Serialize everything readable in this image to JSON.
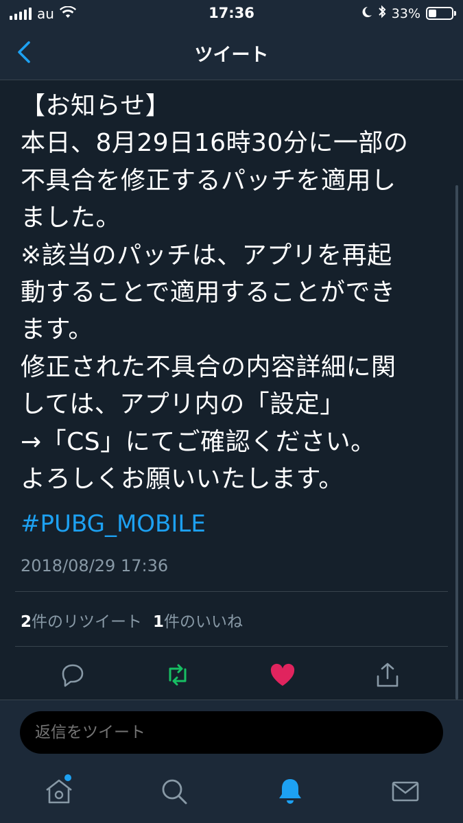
{
  "status_bar": {
    "carrier": "au",
    "time": "17:36",
    "battery": "33%",
    "battery_level": 0.33
  },
  "nav": {
    "title": "ツイート"
  },
  "tweet": {
    "text": "【お知らせ】\n本日、8月29日16時30分に一部の\n不具合を修正するパッチを適用し\nました。\n※該当のパッチは、アプリを再起\n動することで適用することができ\nます。\n修正された不具合の内容詳細に関\nしては、アプリ内の「設定」\n→「CS」にてご確認ください。\nよろしくお願いいたします。",
    "hashtag": "#PUBG_MOBILE",
    "timestamp": "2018/08/29 17:36",
    "retweet_count": "2",
    "retweet_label": "件のリツイート",
    "like_count": "1",
    "like_label": "件のいいね"
  },
  "actions": [
    {
      "icon": "reply-icon"
    },
    {
      "icon": "retweet-icon",
      "color": "#17bf63"
    },
    {
      "icon": "like-icon",
      "color": "#e0245e"
    },
    {
      "icon": "share-icon"
    }
  ],
  "reply": {
    "placeholder": "返信をツイート"
  },
  "tabs": [
    {
      "icon": "home-icon",
      "has_badge": true
    },
    {
      "icon": "search-icon"
    },
    {
      "icon": "notifications-icon",
      "active": true
    },
    {
      "icon": "messages-icon"
    }
  ],
  "colors": {
    "background": "#15202b",
    "bar": "#1c2938",
    "accent": "#1da1f2",
    "muted": "#8899a6"
  }
}
